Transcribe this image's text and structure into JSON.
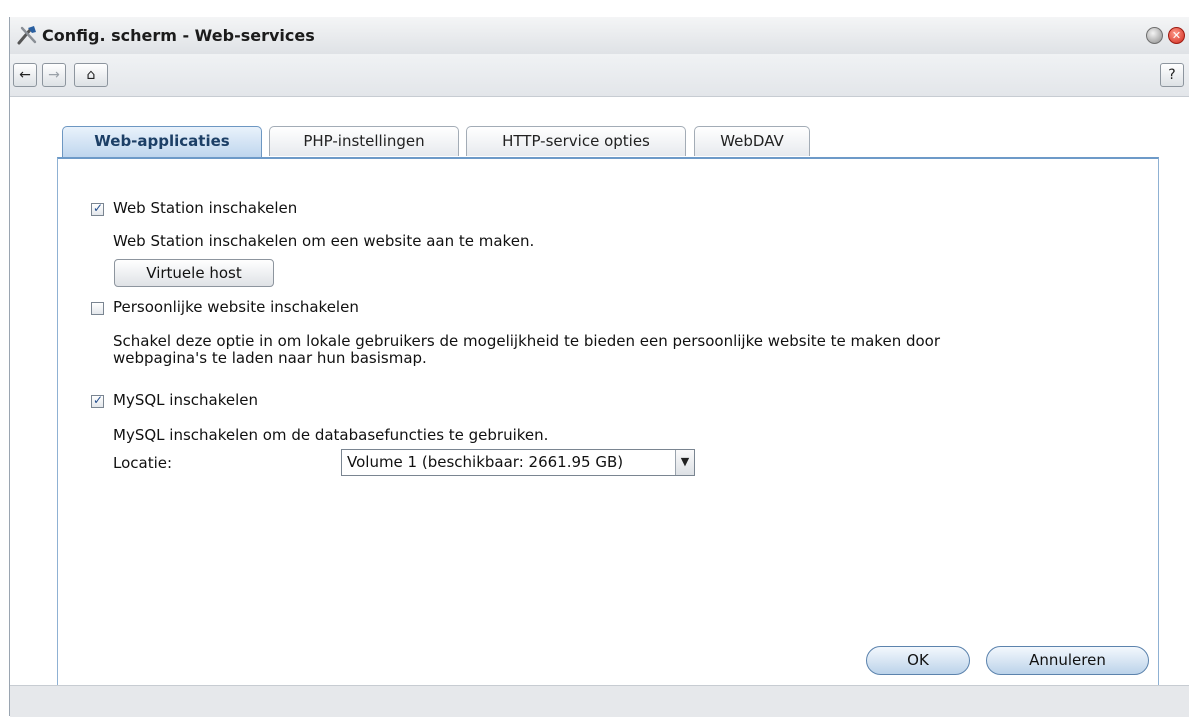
{
  "window": {
    "title": "Config. scherm - Web-services",
    "app_icon": "tools-icon",
    "close_symbol": "✕"
  },
  "toolbar": {
    "back_icon": "←",
    "forward_icon": "→",
    "home_icon": "⌂",
    "help_label": "?"
  },
  "tabs": [
    {
      "label": "Web-applicaties",
      "active": true
    },
    {
      "label": "PHP-instellingen",
      "active": false
    },
    {
      "label": "HTTP-service opties",
      "active": false
    },
    {
      "label": "WebDAV",
      "active": false
    }
  ],
  "web_station": {
    "checkbox_label": "Web Station inschakelen",
    "checked": true,
    "description": "Web Station inschakelen om een website aan te maken.",
    "virtual_host_button": "Virtuele host"
  },
  "personal_site": {
    "checkbox_label": "Persoonlijke website inschakelen",
    "checked": false,
    "description_line1": "Schakel deze optie in om lokale gebruikers de mogelijkheid te bieden een persoonlijke website te maken door",
    "description_line2": "webpagina's te laden naar hun basismap."
  },
  "mysql": {
    "checkbox_label": "MySQL inschakelen",
    "checked": true,
    "description": "MySQL inschakelen om de databasefuncties te gebruiken.",
    "location_label": "Locatie:",
    "location_value": "Volume 1 (beschikbaar: 2661.95 GB)"
  },
  "actions": {
    "ok_label": "OK",
    "cancel_label": "Annuleren"
  },
  "colors": {
    "accent": "#6d9ac8",
    "check": "#254f8e"
  }
}
